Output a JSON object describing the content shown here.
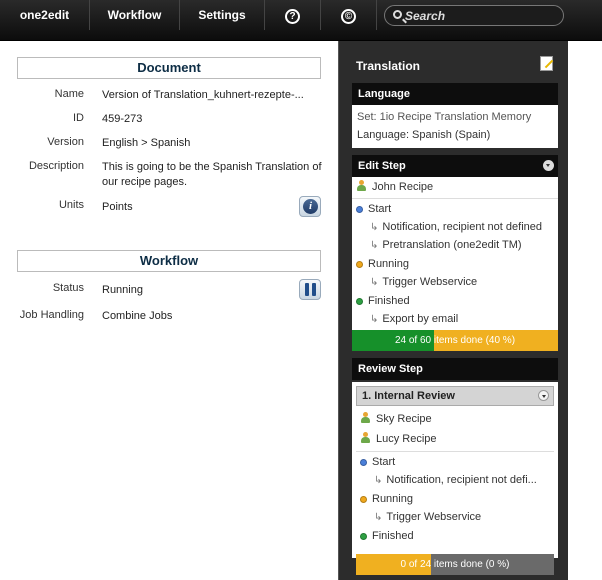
{
  "nav": {
    "app_label": "one2edit",
    "workflow_label": "Workflow",
    "settings_label": "Settings",
    "help_glyph": "?",
    "copyright_glyph": "©",
    "search_placeholder": "Search"
  },
  "document": {
    "header": "Document",
    "fields": [
      {
        "label": "Name",
        "value": "Version of Translation_kuhnert-rezepte-..."
      },
      {
        "label": "ID",
        "value": "459-273"
      },
      {
        "label": "Version",
        "value": "English > Spanish"
      },
      {
        "label": "Description",
        "value": "This is going to be the Spanish Translation of our recipe pages."
      },
      {
        "label": "Units",
        "value": "Points"
      }
    ]
  },
  "workflow": {
    "header": "Workflow",
    "fields": [
      {
        "label": "Status",
        "value": "Running"
      },
      {
        "label": "Job Handling",
        "value": "Combine Jobs"
      }
    ]
  },
  "translation": {
    "title": "Translation",
    "language": {
      "header": "Language",
      "set_line": "Set: 1io Recipe Translation Memory",
      "language_line": "Language: Spanish (Spain)"
    },
    "edit_step": {
      "header": "Edit Step",
      "user": "John Recipe",
      "start": "Start",
      "start_sub1": "Notification, recipient not defined",
      "start_sub2": "Pretranslation (one2edit TM)",
      "running": "Running",
      "running_sub": "Trigger Webservice",
      "finished": "Finished",
      "finished_sub": "Export by email",
      "progress_label": "24 of 60 items done (40 %)",
      "progress_fraction": 0.4
    },
    "review_step": {
      "header": "Review Step",
      "sub_header": "1. Internal Review",
      "user1": "Sky Recipe",
      "user2": "Lucy Recipe",
      "start": "Start",
      "start_sub": "Notification, recipient not defi...",
      "running": "Running",
      "running_sub": "Trigger Webservice",
      "finished": "Finished",
      "progress_label": "0 of 24 items done (0 %)",
      "progress_fraction": 0.0
    }
  },
  "colors": {
    "dot_start": "#4a7fd9",
    "dot_running": "#f0a81c",
    "dot_finished": "#2ea043",
    "progress_done": "#16902a",
    "progress_edit_remaining": "#f0b020",
    "progress_review_remaining": "#6a6a6a"
  }
}
